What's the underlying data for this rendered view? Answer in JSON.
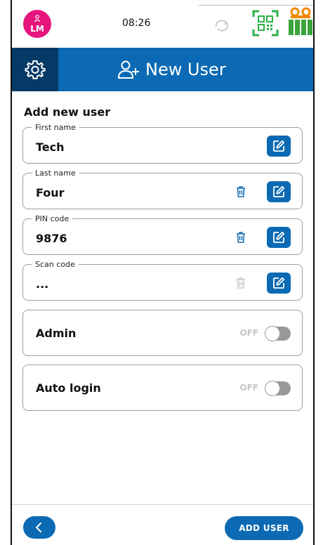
{
  "status_bar": {
    "avatar_initials": "LM",
    "time": "08:26",
    "icons": [
      "user-icon",
      "sync-icon",
      "qr-code-icon",
      "battery-icon"
    ],
    "avatar_color": "#e6157d",
    "qr_color": "#2db34a",
    "battery_color": "#3aa63a",
    "battery_accent": "#f08a00"
  },
  "header": {
    "title": "New User",
    "icons": [
      "gear-icon",
      "add-user-icon"
    ],
    "bg_color": "#0b6ab3",
    "gear_bg_color": "#063a66"
  },
  "form": {
    "section_title": "Add new user",
    "fields": [
      {
        "label": "First name",
        "value": "Tech"
      },
      {
        "label": "Last name",
        "value": "Four"
      },
      {
        "label": "PIN code",
        "value": "9876"
      },
      {
        "label": "Scan code",
        "value": "..."
      }
    ],
    "toggles": [
      {
        "label": "Admin",
        "state": "OFF"
      },
      {
        "label": "Auto login",
        "state": "OFF"
      }
    ]
  },
  "footer": {
    "add_label": "ADD USER",
    "icons": [
      "back-chevron-icon"
    ]
  }
}
